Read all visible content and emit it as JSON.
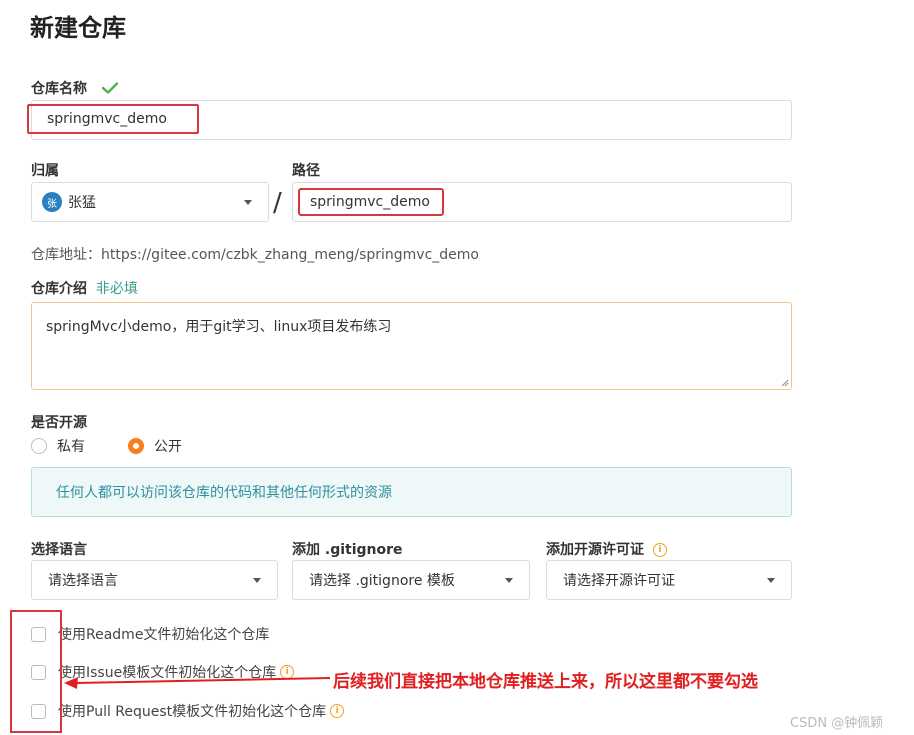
{
  "page": {
    "title": "新建仓库"
  },
  "repo_name": {
    "label": "仓库名称",
    "value": "springmvc_demo"
  },
  "owner": {
    "label": "归属",
    "avatar_text": "张",
    "value": "张猛"
  },
  "separator": "/",
  "path": {
    "label": "路径",
    "value": "springmvc_demo"
  },
  "repo_url": {
    "text": "仓库地址：https://gitee.com/czbk_zhang_meng/springmvc_demo"
  },
  "intro": {
    "label": "仓库介绍",
    "optional": "非必填",
    "value": "springMvc小demo，用于git学习、linux项目发布练习"
  },
  "visibility": {
    "label": "是否开源",
    "options": [
      {
        "label": "私有",
        "selected": false
      },
      {
        "label": "公开",
        "selected": true
      }
    ],
    "notice": "任何人都可以访问该仓库的代码和其他任何形式的资源"
  },
  "language": {
    "label": "选择语言",
    "value": "请选择语言"
  },
  "gitignore": {
    "label": "添加 .gitignore",
    "value": "请选择 .gitignore 模板"
  },
  "license": {
    "label": "添加开源许可证",
    "value": "请选择开源许可证"
  },
  "init_options": [
    {
      "label": "使用Readme文件初始化这个仓库",
      "info": false,
      "checked": false
    },
    {
      "label": "使用Issue模板文件初始化这个仓库",
      "info": true,
      "checked": false
    },
    {
      "label": "使用Pull Request模板文件初始化这个仓库",
      "info": true,
      "checked": false
    }
  ],
  "annotation": {
    "text": "后续我们直接把本地仓库推送上来，所以这里都不要勾选"
  },
  "watermark": {
    "text": "CSDN @钟佩颖"
  },
  "colors": {
    "accent": "#fa7e1e",
    "highlight": "#d9363e",
    "check": "#4caf50",
    "notice_text": "#2f8fa0"
  }
}
